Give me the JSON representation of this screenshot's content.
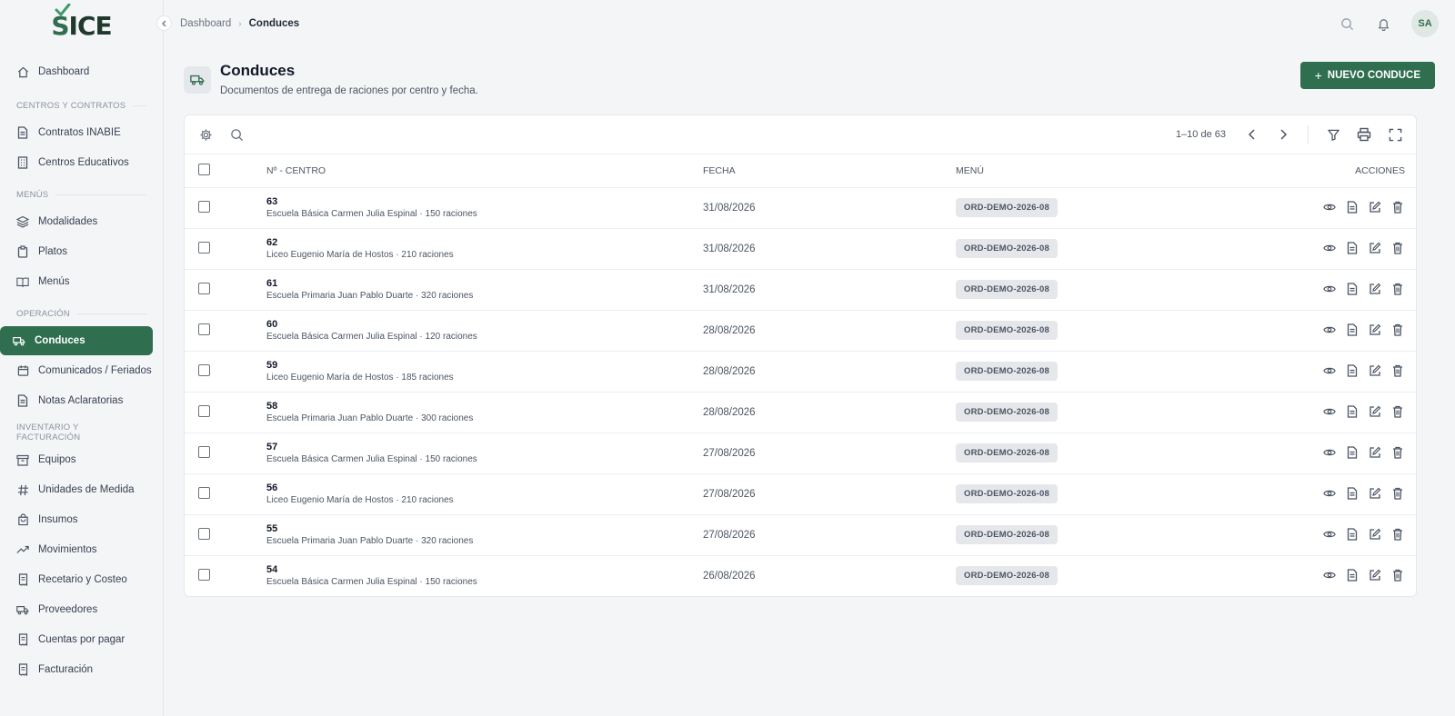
{
  "brand": {
    "name": "SICE",
    "accent": "#2f6e4f"
  },
  "sidebar": {
    "sections": [
      {
        "label": "",
        "items": [
          {
            "label": "Dashboard",
            "icon": "home-icon"
          }
        ]
      },
      {
        "label": "CENTROS Y CONTRATOS",
        "items": [
          {
            "label": "Contratos INABIE",
            "icon": "document-icon"
          },
          {
            "label": "Centros Educativos",
            "icon": "building-icon"
          }
        ]
      },
      {
        "label": "MENÚS",
        "items": [
          {
            "label": "Modalidades",
            "icon": "layers-icon"
          },
          {
            "label": "Platos",
            "icon": "clipboard-icon"
          },
          {
            "label": "Menús",
            "icon": "book-icon"
          }
        ]
      },
      {
        "label": "OPERACIÓN",
        "items": [
          {
            "label": "Conduces",
            "icon": "truck-icon",
            "active": true
          },
          {
            "label": "Comunicados / Feriados",
            "icon": "calendar-icon"
          },
          {
            "label": "Notas Aclaratorias",
            "icon": "document-icon"
          }
        ]
      },
      {
        "label": "INVENTARIO Y FACTURACIÓN",
        "items": [
          {
            "label": "Equipos",
            "icon": "archive-icon"
          },
          {
            "label": "Unidades de Medida",
            "icon": "hash-icon"
          },
          {
            "label": "Insumos",
            "icon": "bag-icon"
          },
          {
            "label": "Movimientos",
            "icon": "trend-icon"
          },
          {
            "label": "Recetario y Costeo",
            "icon": "receipt-icon"
          },
          {
            "label": "Proveedores",
            "icon": "truck-icon"
          },
          {
            "label": "Cuentas por pagar",
            "icon": "receipt-icon"
          },
          {
            "label": "Facturación",
            "icon": "receipt-icon"
          }
        ]
      }
    ]
  },
  "topbar": {
    "breadcrumb": [
      "Dashboard",
      "Conduces"
    ],
    "avatar": "SA"
  },
  "page": {
    "title": "Conduces",
    "subtitle": "Documentos de entrega de raciones por centro y fecha.",
    "new_button": "NUEVO CONDUCE"
  },
  "table": {
    "pagination": "1–10 de 63",
    "headers": {
      "centro": "Nº - CENTRO",
      "fecha": "FECHA",
      "menu": "MENÚ",
      "acciones": "ACCIONES"
    },
    "rows": [
      {
        "num": "63",
        "detail": "Escuela Básica Carmen Julia Espinal · 150 raciones",
        "fecha": "31/08/2026",
        "menu": "ORD-DEMO-2026-08"
      },
      {
        "num": "62",
        "detail": "Liceo Eugenio María de Hostos · 210 raciones",
        "fecha": "31/08/2026",
        "menu": "ORD-DEMO-2026-08"
      },
      {
        "num": "61",
        "detail": "Escuela Primaria Juan Pablo Duarte · 320 raciones",
        "fecha": "31/08/2026",
        "menu": "ORD-DEMO-2026-08"
      },
      {
        "num": "60",
        "detail": "Escuela Básica Carmen Julia Espinal · 120 raciones",
        "fecha": "28/08/2026",
        "menu": "ORD-DEMO-2026-08"
      },
      {
        "num": "59",
        "detail": "Liceo Eugenio María de Hostos · 185 raciones",
        "fecha": "28/08/2026",
        "menu": "ORD-DEMO-2026-08"
      },
      {
        "num": "58",
        "detail": "Escuela Primaria Juan Pablo Duarte · 300 raciones",
        "fecha": "28/08/2026",
        "menu": "ORD-DEMO-2026-08"
      },
      {
        "num": "57",
        "detail": "Escuela Básica Carmen Julia Espinal · 150 raciones",
        "fecha": "27/08/2026",
        "menu": "ORD-DEMO-2026-08"
      },
      {
        "num": "56",
        "detail": "Liceo Eugenio María de Hostos · 210 raciones",
        "fecha": "27/08/2026",
        "menu": "ORD-DEMO-2026-08"
      },
      {
        "num": "55",
        "detail": "Escuela Primaria Juan Pablo Duarte · 320 raciones",
        "fecha": "27/08/2026",
        "menu": "ORD-DEMO-2026-08"
      },
      {
        "num": "54",
        "detail": "Escuela Básica Carmen Julia Espinal · 150 raciones",
        "fecha": "26/08/2026",
        "menu": "ORD-DEMO-2026-08"
      }
    ]
  }
}
